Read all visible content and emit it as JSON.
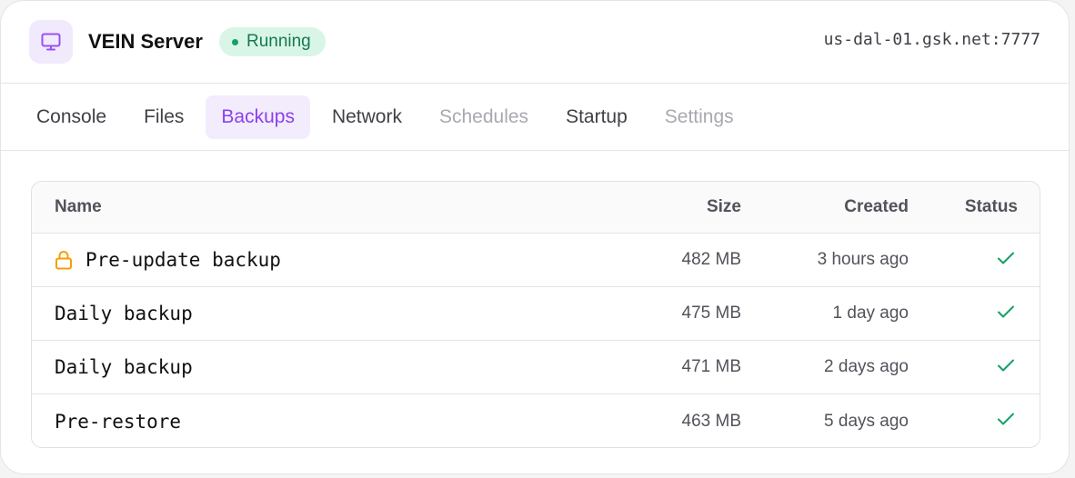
{
  "header": {
    "title": "VEIN Server",
    "status": "Running",
    "host": "us-dal-01.gsk.net:7777",
    "icon": "monitor-icon"
  },
  "tabs": [
    {
      "label": "Console",
      "state": "normal"
    },
    {
      "label": "Files",
      "state": "normal"
    },
    {
      "label": "Backups",
      "state": "active"
    },
    {
      "label": "Network",
      "state": "normal"
    },
    {
      "label": "Schedules",
      "state": "disabled"
    },
    {
      "label": "Startup",
      "state": "normal"
    },
    {
      "label": "Settings",
      "state": "disabled"
    }
  ],
  "table": {
    "columns": {
      "name": "Name",
      "size": "Size",
      "created": "Created",
      "status": "Status"
    },
    "rows": [
      {
        "name": "Pre-update backup",
        "size": "482 MB",
        "created": "3 hours ago",
        "locked": true,
        "status_icon": "check-icon"
      },
      {
        "name": "Daily backup",
        "size": "475 MB",
        "created": "1 day ago",
        "locked": false,
        "status_icon": "check-icon"
      },
      {
        "name": "Daily backup",
        "size": "471 MB",
        "created": "2 days ago",
        "locked": false,
        "status_icon": "check-icon"
      },
      {
        "name": "Pre-restore",
        "size": "463 MB",
        "created": "5 days ago",
        "locked": false,
        "status_icon": "check-icon"
      }
    ]
  },
  "colors": {
    "accent": "#8b3ff0",
    "accent_bg": "#f3ecfd",
    "success": "#16a063",
    "success_bg": "#d9f5e8",
    "lock": "#f5a000"
  }
}
